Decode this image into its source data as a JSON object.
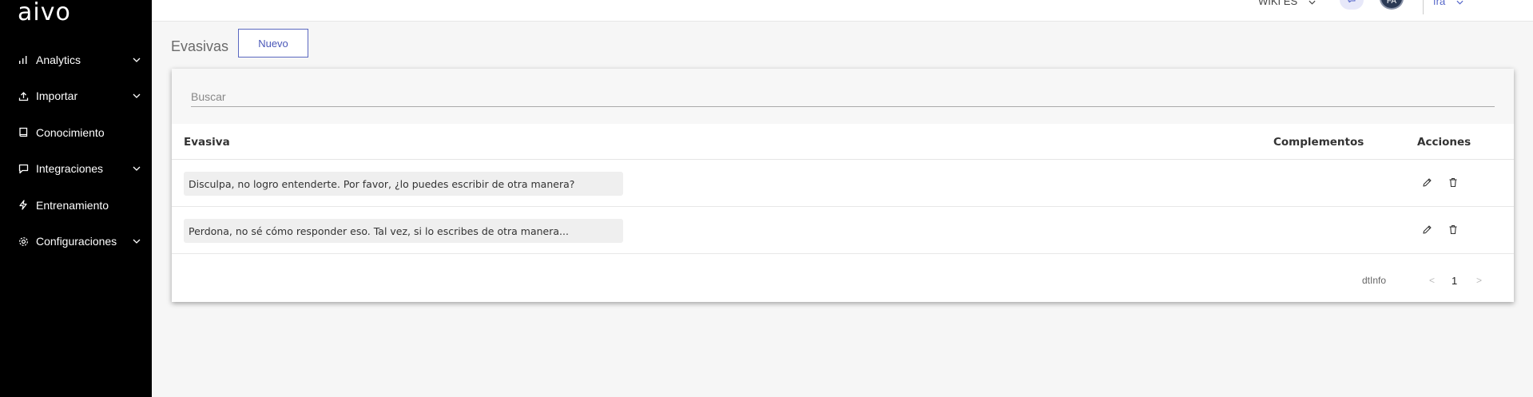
{
  "sidebar": {
    "logo": "aivo",
    "items": [
      {
        "label": "Analytics",
        "icon": "bar-chart-icon",
        "has_submenu": true
      },
      {
        "label": "Importar",
        "icon": "upload-icon",
        "has_submenu": true
      },
      {
        "label": "Conocimiento",
        "icon": "book-icon",
        "has_submenu": false
      },
      {
        "label": "Integraciones",
        "icon": "chat-icon",
        "has_submenu": true
      },
      {
        "label": "Entrenamiento",
        "icon": "bolt-icon",
        "has_submenu": false
      },
      {
        "label": "Configuraciones",
        "icon": "gear-icon",
        "has_submenu": true
      }
    ]
  },
  "topbar": {
    "wiki_label": "WIKI ES",
    "avatar_initials": "FA",
    "lang_label": "fra"
  },
  "header": {
    "title": "Evasivas",
    "new_button": "Nuevo"
  },
  "search": {
    "placeholder": "Buscar",
    "value": ""
  },
  "table": {
    "columns": [
      "Evasiva",
      "Complementos",
      "Acciones"
    ],
    "rows": [
      {
        "evasiva": "Disculpa, no logro entenderte. Por favor, ¿lo puedes escribir de otra manera?"
      },
      {
        "evasiva": "Perdona, no sé cómo responder eso. Tal vez, si lo escribes de otra manera..."
      }
    ]
  },
  "pagination": {
    "info": "dtInfo",
    "prev": "<",
    "page": "1",
    "next": ">"
  },
  "colors": {
    "sidebar_bg": "#000000",
    "accent": "#4a57b8",
    "page_bg": "#f6f6f6"
  }
}
